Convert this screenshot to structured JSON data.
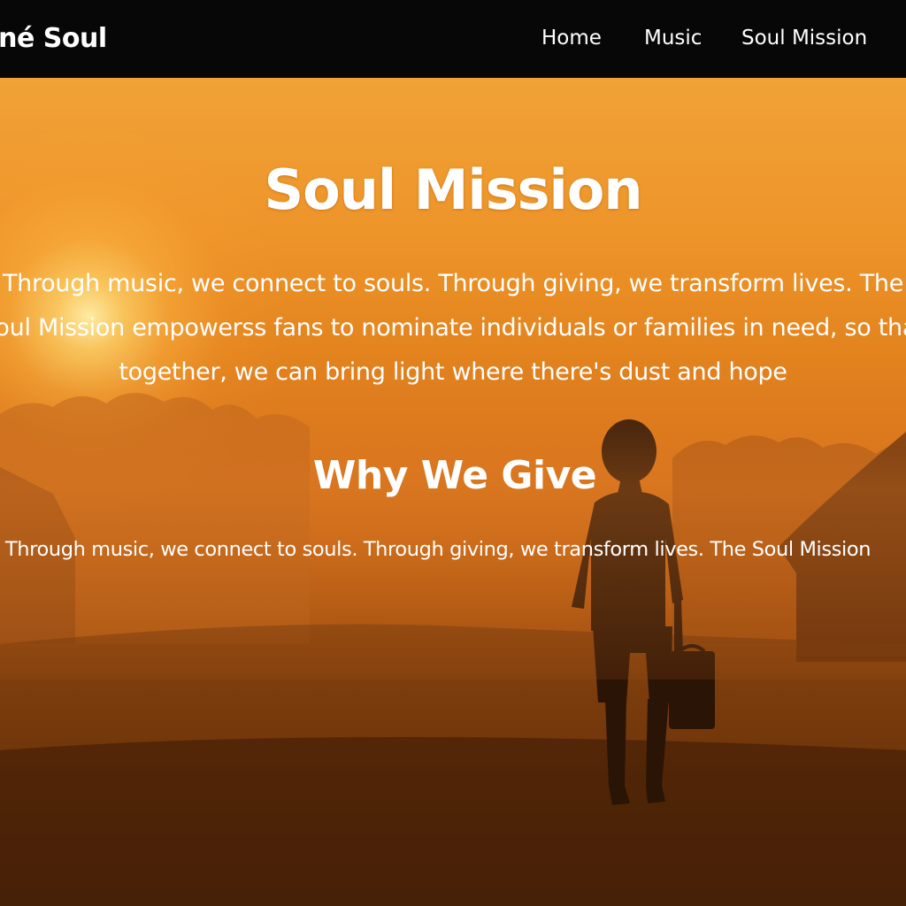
{
  "nav": {
    "brand": "oné Soul",
    "links": [
      {
        "label": "Home"
      },
      {
        "label": "Music"
      },
      {
        "label": "Soul Mission"
      }
    ]
  },
  "hero": {
    "title": "Soul Mission",
    "intro_lines": [
      "Through music, we connect to souls. Through giving, we transform lives. The",
      "Soul Mission empowerss fans to nominate individuals or families in need, so that",
      "together, we can bring light where there's dust and hope"
    ],
    "background_image": "sunset-child-silhouette"
  },
  "why": {
    "title": "Why We Give",
    "text": "Through music, we connect to souls. Through giving, we transform lives. The Soul Mission"
  },
  "colors": {
    "nav_background": "#070707",
    "text": "#ffffff",
    "sky_top": "#f0a236",
    "ground": "#3c1c06"
  }
}
